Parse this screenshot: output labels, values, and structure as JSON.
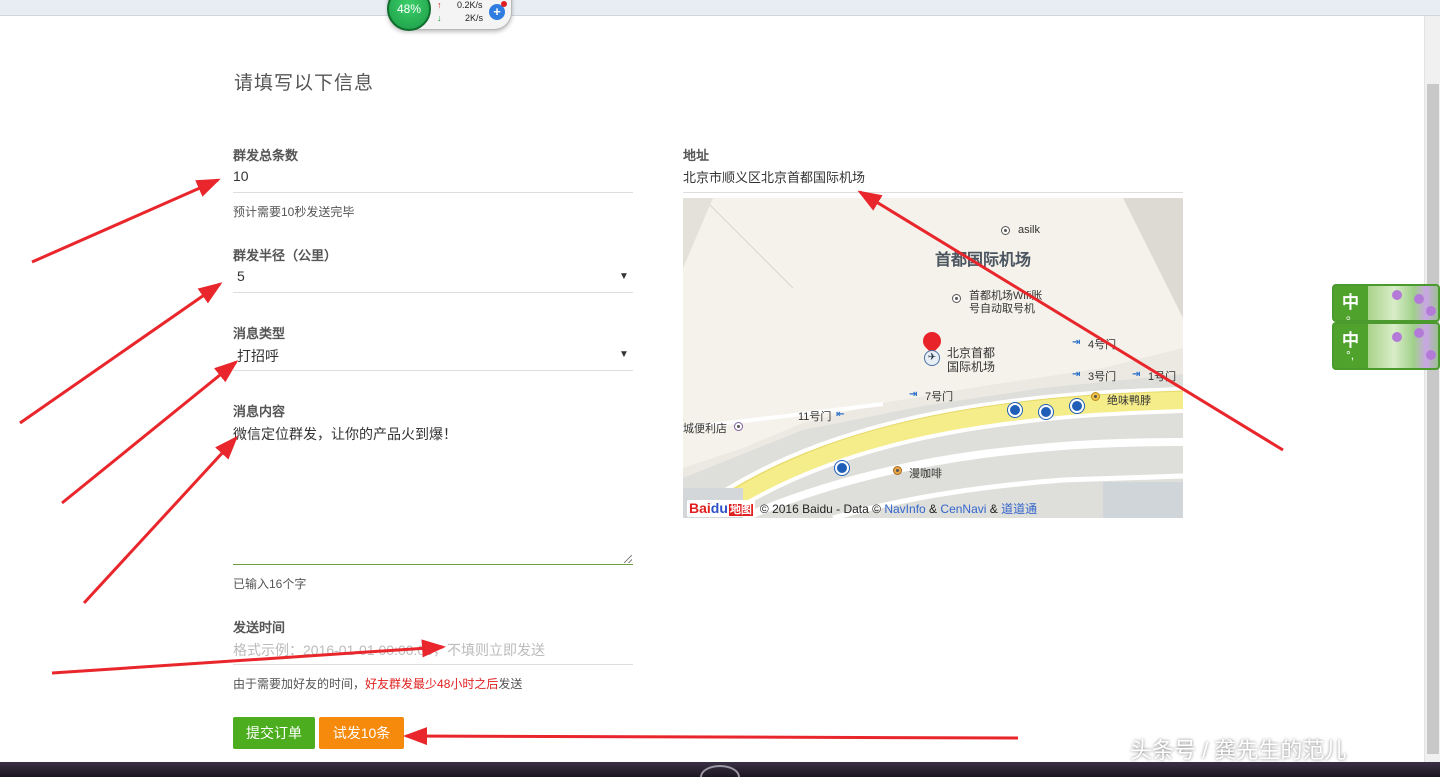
{
  "form": {
    "title": "请填写以下信息",
    "total_count": {
      "label": "群发总条数",
      "value": "10",
      "hint": "预计需要10秒发送完毕"
    },
    "radius": {
      "label": "群发半径（公里）",
      "value": "5"
    },
    "message_type": {
      "label": "消息类型",
      "value": "打招呼"
    },
    "message_content": {
      "label": "消息内容",
      "value": "微信定位群发，让你的产品火到爆！",
      "hint": "已输入16个字"
    },
    "send_time": {
      "label": "发送时间",
      "placeholder": "格式示例：2016-01-01 00:00:00，不填则立即发送",
      "note_prefix": "由于需要加好友的时间，",
      "note_warning": "好友群发最少48小时之后",
      "note_suffix": "发送"
    },
    "buttons": {
      "submit": "提交订单",
      "trial": "试发10条"
    }
  },
  "address": {
    "label": "地址",
    "value": "北京市顺义区北京首都国际机场"
  },
  "map": {
    "area_title": "首都国际机场",
    "pois": {
      "asilk": "asilk",
      "wifi_line1": "首都机场Wifi账",
      "wifi_line2": "号自动取号机",
      "airport_line1": "北京首都",
      "airport_line2": "国际机场",
      "gate4": "4号门",
      "gate3": "3号门",
      "gate1": "1号门",
      "gate7": "7号门",
      "gate11": "11号门",
      "store": "城便利店",
      "duck": "绝味鸭脖",
      "cafe": "漫咖啡"
    },
    "copyright_text": "© 2016 Baidu - Data ©",
    "copyright_link1": "NavInfo",
    "copyright_amp1": "&",
    "copyright_link2": "CenNavi",
    "copyright_amp2": "&",
    "copyright_link3": "道道通",
    "logo_text_1": "Bai",
    "logo_text_2": "du",
    "logo_text_3": "地图"
  },
  "network_widget": {
    "percent": "48%",
    "up_speed": "0.2K/s",
    "down_speed": "2K/s",
    "up_arrow": "↑",
    "down_arrow": "↓",
    "plus": "+"
  },
  "ime": [
    {
      "char": "中",
      "mark": "。"
    },
    {
      "char": "中",
      "mark": "°,"
    }
  ],
  "watermark": "头条号 / 龚先生的范儿",
  "colors": {
    "submit": "#4cae1f",
    "trial": "#f58a0d",
    "arrow": "#e8262b",
    "warning": "#e02020"
  }
}
